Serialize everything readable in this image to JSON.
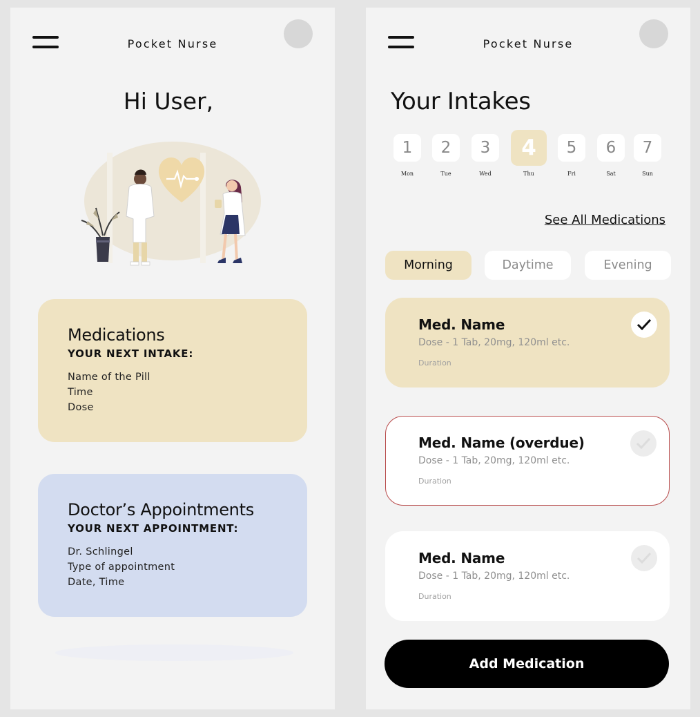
{
  "app": {
    "title": "Pocket Nurse"
  },
  "colors": {
    "accent": "#efe3c2",
    "appointment": "#d3dcf0",
    "overdue_border": "#b84a4a",
    "primary_button": "#000000"
  },
  "home": {
    "greeting": "Hi User,",
    "illustration": "doctors-heart-illustration",
    "medications": {
      "title": "Medications",
      "subtitle": "YOUR NEXT INTAKE:",
      "lines": [
        "Name of the Pill",
        "Time",
        "Dose"
      ]
    },
    "appointments": {
      "title": "Doctor’s Appointments",
      "subtitle": "YOUR NEXT APPOINTMENT:",
      "lines": [
        "Dr. Schlingel",
        "Type of appointment",
        "Date, Time"
      ]
    }
  },
  "intakes": {
    "title": "Your Intakes",
    "days": [
      {
        "num": "1",
        "label": "Mon"
      },
      {
        "num": "2",
        "label": "Tue"
      },
      {
        "num": "3",
        "label": "Wed"
      },
      {
        "num": "4",
        "label": "Thu"
      },
      {
        "num": "5",
        "label": "Fri"
      },
      {
        "num": "6",
        "label": "Sat"
      },
      {
        "num": "7",
        "label": "Sun"
      }
    ],
    "selected_day": "4",
    "see_all": "See All Medications",
    "tabs": [
      "Morning",
      "Daytime",
      "Evening"
    ],
    "active_tab": "Morning",
    "meds": [
      {
        "name": "Med. Name",
        "dose": "Dose - 1 Tab, 20mg, 120ml etc.",
        "duration": "Duration",
        "status": "taken"
      },
      {
        "name": "Med. Name (overdue)",
        "dose": "Dose - 1 Tab, 20mg, 120ml etc.",
        "duration": "Duration",
        "status": "overdue"
      },
      {
        "name": "Med. Name",
        "dose": "Dose - 1 Tab, 20mg, 120ml etc.",
        "duration": "Duration",
        "status": "pending"
      }
    ],
    "add_button": "Add Medication"
  }
}
